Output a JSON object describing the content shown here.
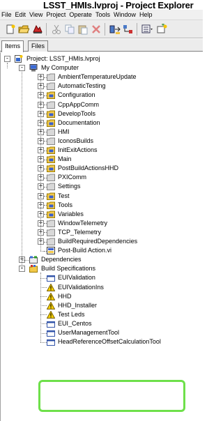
{
  "window": {
    "title": "LSST_HMIs.lvproj - Project Explorer"
  },
  "menu": [
    "File",
    "Edit",
    "View",
    "Project",
    "Operate",
    "Tools",
    "Window",
    "Help"
  ],
  "toolbar": {
    "icons": [
      "new-icon",
      "open-icon",
      "save-all-icon",
      "cut-icon",
      "copy-icon",
      "paste-icon",
      "delete-icon",
      "build-icon",
      "hierarchy-icon",
      "view-options-icon",
      "add-icon"
    ]
  },
  "tabs": [
    {
      "label": "Items",
      "active": true
    },
    {
      "label": "Files",
      "active": false
    }
  ],
  "tree": {
    "project": "Project: LSST_HMIs.lvproj",
    "computer": "My Computer",
    "folders": [
      {
        "label": "AmbientTemperatureUpdate",
        "color": "gray"
      },
      {
        "label": "AutomaticTesting",
        "color": "gray"
      },
      {
        "label": "Configuration",
        "color": "yellow"
      },
      {
        "label": "CppAppComm",
        "color": "gray"
      },
      {
        "label": "DevelopTools",
        "color": "yellow"
      },
      {
        "label": "Documentation",
        "color": "yellow"
      },
      {
        "label": "HMI",
        "color": "gray"
      },
      {
        "label": "IconosBuilds",
        "color": "gray"
      },
      {
        "label": "InitExitActions",
        "color": "yellow"
      },
      {
        "label": "Main",
        "color": "yellow"
      },
      {
        "label": "PostBuildActionsHHD",
        "color": "yellow"
      },
      {
        "label": "PXIComm",
        "color": "gray"
      },
      {
        "label": "Settings",
        "color": "gray"
      },
      {
        "label": "Test",
        "color": "yellow"
      },
      {
        "label": "Tools",
        "color": "yellow"
      },
      {
        "label": "Variables",
        "color": "yellow"
      },
      {
        "label": "WindowTelemetry",
        "color": "gray"
      },
      {
        "label": "TCP_Telemetry",
        "color": "gray"
      },
      {
        "label": "BuildRequiredDependencies",
        "color": "gray"
      }
    ],
    "vi": "Post-Build Action.vi",
    "dependencies": "Dependencies",
    "build_specs": "Build Specifications",
    "builds": [
      {
        "label": "EUIValidation",
        "warning": false
      },
      {
        "label": "EUIValidationIns",
        "warning": true
      },
      {
        "label": "HHD",
        "warning": true
      },
      {
        "label": "HHD_Installer",
        "warning": true
      },
      {
        "label": "Test Leds",
        "warning": true
      },
      {
        "label": "EUI_Centos",
        "warning": false
      },
      {
        "label": "UserManagementTool",
        "warning": false
      },
      {
        "label": "HeadReferenceOffsetCalculationTool",
        "warning": false
      }
    ]
  },
  "highlight_color": "#6ee04a"
}
